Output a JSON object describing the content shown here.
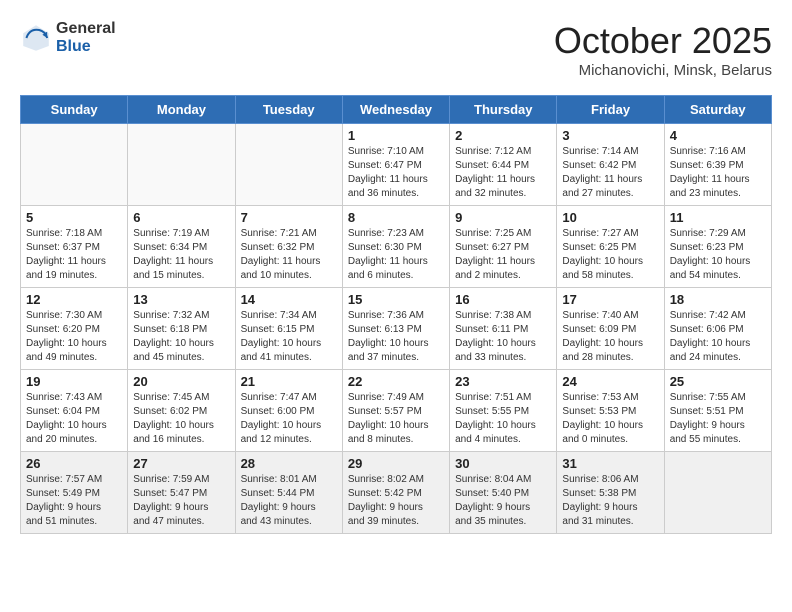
{
  "header": {
    "logo_general": "General",
    "logo_blue": "Blue",
    "month": "October 2025",
    "location": "Michanovichi, Minsk, Belarus"
  },
  "weekdays": [
    "Sunday",
    "Monday",
    "Tuesday",
    "Wednesday",
    "Thursday",
    "Friday",
    "Saturday"
  ],
  "weeks": [
    [
      {
        "day": "",
        "info": ""
      },
      {
        "day": "",
        "info": ""
      },
      {
        "day": "",
        "info": ""
      },
      {
        "day": "1",
        "info": "Sunrise: 7:10 AM\nSunset: 6:47 PM\nDaylight: 11 hours\nand 36 minutes."
      },
      {
        "day": "2",
        "info": "Sunrise: 7:12 AM\nSunset: 6:44 PM\nDaylight: 11 hours\nand 32 minutes."
      },
      {
        "day": "3",
        "info": "Sunrise: 7:14 AM\nSunset: 6:42 PM\nDaylight: 11 hours\nand 27 minutes."
      },
      {
        "day": "4",
        "info": "Sunrise: 7:16 AM\nSunset: 6:39 PM\nDaylight: 11 hours\nand 23 minutes."
      }
    ],
    [
      {
        "day": "5",
        "info": "Sunrise: 7:18 AM\nSunset: 6:37 PM\nDaylight: 11 hours\nand 19 minutes."
      },
      {
        "day": "6",
        "info": "Sunrise: 7:19 AM\nSunset: 6:34 PM\nDaylight: 11 hours\nand 15 minutes."
      },
      {
        "day": "7",
        "info": "Sunrise: 7:21 AM\nSunset: 6:32 PM\nDaylight: 11 hours\nand 10 minutes."
      },
      {
        "day": "8",
        "info": "Sunrise: 7:23 AM\nSunset: 6:30 PM\nDaylight: 11 hours\nand 6 minutes."
      },
      {
        "day": "9",
        "info": "Sunrise: 7:25 AM\nSunset: 6:27 PM\nDaylight: 11 hours\nand 2 minutes."
      },
      {
        "day": "10",
        "info": "Sunrise: 7:27 AM\nSunset: 6:25 PM\nDaylight: 10 hours\nand 58 minutes."
      },
      {
        "day": "11",
        "info": "Sunrise: 7:29 AM\nSunset: 6:23 PM\nDaylight: 10 hours\nand 54 minutes."
      }
    ],
    [
      {
        "day": "12",
        "info": "Sunrise: 7:30 AM\nSunset: 6:20 PM\nDaylight: 10 hours\nand 49 minutes."
      },
      {
        "day": "13",
        "info": "Sunrise: 7:32 AM\nSunset: 6:18 PM\nDaylight: 10 hours\nand 45 minutes."
      },
      {
        "day": "14",
        "info": "Sunrise: 7:34 AM\nSunset: 6:15 PM\nDaylight: 10 hours\nand 41 minutes."
      },
      {
        "day": "15",
        "info": "Sunrise: 7:36 AM\nSunset: 6:13 PM\nDaylight: 10 hours\nand 37 minutes."
      },
      {
        "day": "16",
        "info": "Sunrise: 7:38 AM\nSunset: 6:11 PM\nDaylight: 10 hours\nand 33 minutes."
      },
      {
        "day": "17",
        "info": "Sunrise: 7:40 AM\nSunset: 6:09 PM\nDaylight: 10 hours\nand 28 minutes."
      },
      {
        "day": "18",
        "info": "Sunrise: 7:42 AM\nSunset: 6:06 PM\nDaylight: 10 hours\nand 24 minutes."
      }
    ],
    [
      {
        "day": "19",
        "info": "Sunrise: 7:43 AM\nSunset: 6:04 PM\nDaylight: 10 hours\nand 20 minutes."
      },
      {
        "day": "20",
        "info": "Sunrise: 7:45 AM\nSunset: 6:02 PM\nDaylight: 10 hours\nand 16 minutes."
      },
      {
        "day": "21",
        "info": "Sunrise: 7:47 AM\nSunset: 6:00 PM\nDaylight: 10 hours\nand 12 minutes."
      },
      {
        "day": "22",
        "info": "Sunrise: 7:49 AM\nSunset: 5:57 PM\nDaylight: 10 hours\nand 8 minutes."
      },
      {
        "day": "23",
        "info": "Sunrise: 7:51 AM\nSunset: 5:55 PM\nDaylight: 10 hours\nand 4 minutes."
      },
      {
        "day": "24",
        "info": "Sunrise: 7:53 AM\nSunset: 5:53 PM\nDaylight: 10 hours\nand 0 minutes."
      },
      {
        "day": "25",
        "info": "Sunrise: 7:55 AM\nSunset: 5:51 PM\nDaylight: 9 hours\nand 55 minutes."
      }
    ],
    [
      {
        "day": "26",
        "info": "Sunrise: 7:57 AM\nSunset: 5:49 PM\nDaylight: 9 hours\nand 51 minutes."
      },
      {
        "day": "27",
        "info": "Sunrise: 7:59 AM\nSunset: 5:47 PM\nDaylight: 9 hours\nand 47 minutes."
      },
      {
        "day": "28",
        "info": "Sunrise: 8:01 AM\nSunset: 5:44 PM\nDaylight: 9 hours\nand 43 minutes."
      },
      {
        "day": "29",
        "info": "Sunrise: 8:02 AM\nSunset: 5:42 PM\nDaylight: 9 hours\nand 39 minutes."
      },
      {
        "day": "30",
        "info": "Sunrise: 8:04 AM\nSunset: 5:40 PM\nDaylight: 9 hours\nand 35 minutes."
      },
      {
        "day": "31",
        "info": "Sunrise: 8:06 AM\nSunset: 5:38 PM\nDaylight: 9 hours\nand 31 minutes."
      },
      {
        "day": "",
        "info": ""
      }
    ]
  ]
}
